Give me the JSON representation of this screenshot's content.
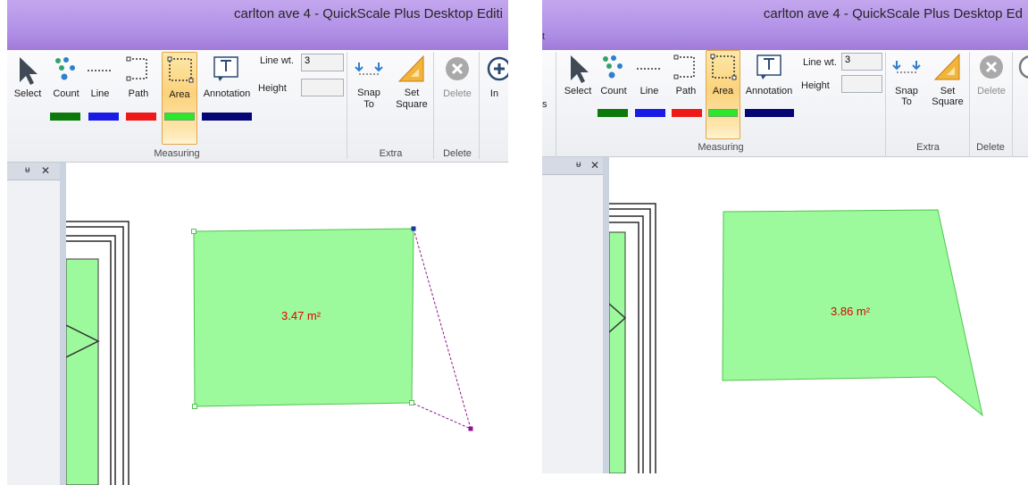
{
  "left_panel": {
    "title": "carlton ave 4 - QuickScale Plus Desktop Editi",
    "ribbon": {
      "tools": {
        "select": "Select",
        "count": "Count",
        "line": "Line",
        "path": "Path",
        "area": "Area",
        "annotation": "Annotation"
      },
      "line_wt_label": "Line wt.",
      "line_wt_value": "3",
      "height_label": "Height",
      "height_value": "",
      "snap_to": [
        "Snap",
        "To"
      ],
      "set_square": [
        "Set",
        "Square"
      ],
      "delete": "Delete",
      "insert_fragment": "In",
      "group_measuring": "Measuring",
      "group_extra": "Extra",
      "group_delete": "Delete",
      "swatch_colors": [
        "#0b7a0b",
        "#1a1ae6",
        "#ee1a1a",
        "#2be82b",
        "#050575"
      ]
    },
    "dock": {
      "pin": "ᵾ",
      "close": "✕"
    },
    "measurement": {
      "area_label": "3.47 m²",
      "fill": "#9cfa9c",
      "edge": "#4fc44f",
      "label_color": "#e00000",
      "guide_color": "#8c1a8c"
    }
  },
  "right_panel": {
    "title": "carlton ave 4 - QuickScale Plus Desktop Ed",
    "menu_fragment": "t",
    "ribbon": {
      "tools": {
        "select": "Select",
        "count": "Count",
        "line": "Line",
        "path": "Path",
        "area": "Area",
        "annotation": "Annotation"
      },
      "left_fragment": "s",
      "line_wt_label": "Line wt.",
      "line_wt_value": "3",
      "height_label": "Height",
      "height_value": "",
      "snap_to": [
        "Snap",
        "To"
      ],
      "set_square": [
        "Set",
        "Square"
      ],
      "delete": "Delete",
      "group_measuring": "Measuring",
      "group_extra": "Extra",
      "group_delete": "Delete",
      "swatch_colors": [
        "#0b7a0b",
        "#1a1ae6",
        "#ee1a1a",
        "#2be82b",
        "#050575"
      ]
    },
    "dock": {
      "pin": "ᵾ",
      "close": "✕"
    },
    "measurement": {
      "area_label": "3.86 m²",
      "fill": "#9cfa9c",
      "edge": "#4fc44f",
      "label_color": "#e00000"
    }
  }
}
